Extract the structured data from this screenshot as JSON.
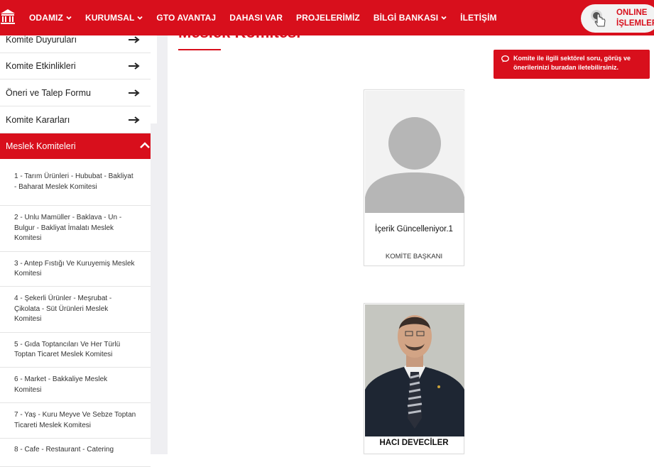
{
  "nav": {
    "items": [
      {
        "label": "ODAMIZ",
        "dropdown": true
      },
      {
        "label": "KURUMSAL",
        "dropdown": true
      },
      {
        "label": "GTO AVANTAJ",
        "dropdown": false
      },
      {
        "label": "DAHASI VAR",
        "dropdown": false
      },
      {
        "label": "PROJELERİMİZ",
        "dropdown": false
      },
      {
        "label": "BİLGİ BANKASI",
        "dropdown": true
      },
      {
        "label": "İLETİŞİM",
        "dropdown": false
      }
    ],
    "online_line1": "ONLINE",
    "online_line2": "İŞLEMLER"
  },
  "sidebar": {
    "items": [
      {
        "label": "Komite Duyuruları"
      },
      {
        "label": "Komite Etkinlikleri"
      },
      {
        "label": "Öneri ve Talep Formu"
      },
      {
        "label": "Komite Kararları"
      }
    ],
    "active_label": "Meslek Komiteleri",
    "sub_items": [
      {
        "label": "1 - Tarım Ürünleri - Hububat - Bakliyat - Baharat Meslek Komitesi"
      },
      {
        "label": "2 - Unlu Mamüller - Baklava - Un - Bulgur - Bakliyat İmalatı Meslek Komitesi"
      },
      {
        "label": "3 - Antep Fıstığı Ve Kuruyemiş Meslek Komitesi"
      },
      {
        "label": "4 - Şekerli Ürünler - Meşrubat - Çikolata - Süt Ürünleri Meslek Komitesi"
      },
      {
        "label": "5 - Gıda Toptancıları Ve Her Türlü Toptan Ticaret Meslek Komitesi"
      },
      {
        "label": "6 - Market - Bakkaliye Meslek Komitesi"
      },
      {
        "label": "7 - Yaş - Kuru Meyve Ve Sebze Toptan Ticareti Meslek Komitesi"
      },
      {
        "label": "8 - Cafe - Restaurant - Catering"
      }
    ]
  },
  "main": {
    "title": "Meslek Komitesi",
    "notice": "Komite ile ilgili sektörel soru, görüş ve önerilerinizi buradan iletebilirsiniz.",
    "members": [
      {
        "name": "İçerik Güncelleniyor.1",
        "role": "KOMİTE BAŞKANI"
      },
      {
        "name": "HACI DEVECİLER",
        "role": ""
      }
    ]
  },
  "colors": {
    "brand": "#d80f1c"
  }
}
